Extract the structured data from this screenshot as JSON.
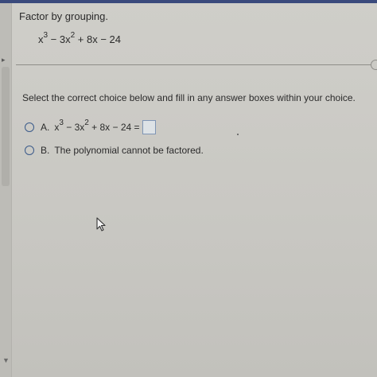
{
  "question": {
    "title": "Factor by grouping.",
    "expression": {
      "base1": "x",
      "exp1": "3",
      "part2": " − 3x",
      "exp2": "2",
      "part3": " + 8x − 24"
    }
  },
  "instruction": "Select the correct choice below and fill in any answer boxes within your choice.",
  "choices": [
    {
      "letter": "A.",
      "expr": {
        "base1": "x",
        "exp1": "3",
        "part2": " − 3x",
        "exp2": "2",
        "part3": " + 8x − 24 ="
      },
      "answer_value": ""
    },
    {
      "letter": "B.",
      "text": "The polynomial cannot be factored."
    }
  ],
  "icons": {
    "radio": "radio-button-icon",
    "cursor": "mouse-pointer-icon",
    "collapse": "collapse-arrow-icon",
    "scroll_down": "scroll-down-icon"
  },
  "colors": {
    "accent": "#3a4a7c",
    "radio": "#3a5a8a",
    "answer_box_border": "#7f95b5"
  }
}
